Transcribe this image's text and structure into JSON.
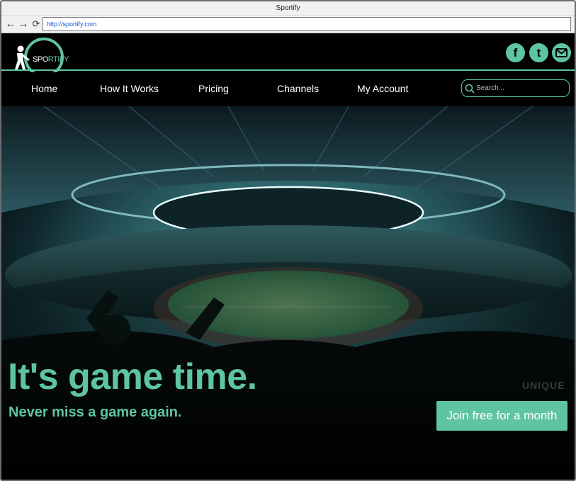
{
  "browser": {
    "title": "Sportify",
    "url": "http://sportify.com",
    "back_icon": "arrow-left-icon",
    "forward_icon": "arrow-right-icon",
    "reload_icon": "reload-icon"
  },
  "brand": {
    "logo_text_part1": "SP",
    "logo_text_part2": "O",
    "logo_text_part3": "RTIFY",
    "accent_color": "#5ec4a4"
  },
  "social": {
    "facebook": "f",
    "twitter": "t",
    "mail_icon": "envelope-icon"
  },
  "menu": {
    "items": [
      "Home",
      "How It Works",
      "Pricing",
      "Channels",
      "My Account"
    ]
  },
  "search": {
    "placeholder": "Search..."
  },
  "hero": {
    "headline": "It's game time.",
    "subline": "Never miss a game again.",
    "cta": "Join free for a month",
    "watermark": "UNIQUE"
  }
}
